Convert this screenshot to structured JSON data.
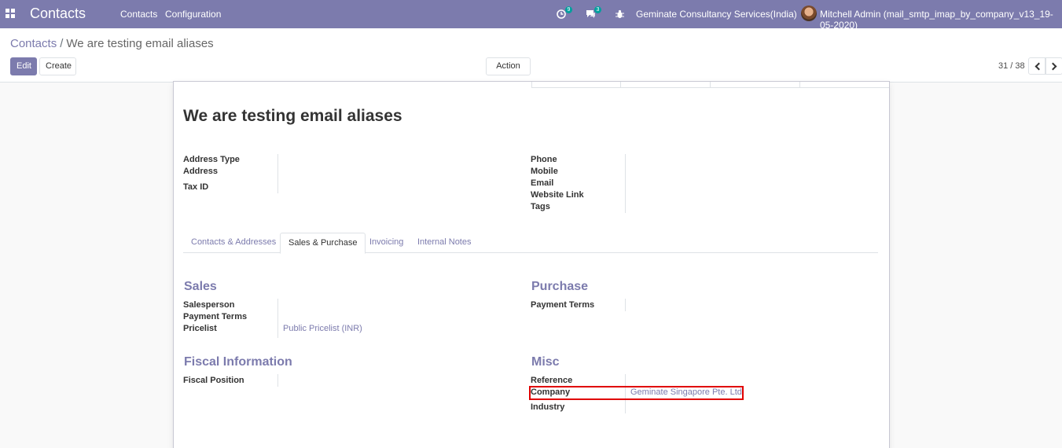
{
  "navbar": {
    "brand": "Contacts",
    "menu": [
      "Contacts",
      "Configuration"
    ],
    "activity_count": "9",
    "messages_count": "3",
    "company": "Geminate Consultancy Services(India)",
    "user": "Mitchell Admin (mail_smtp_imap_by_company_v13_19-05-2020)"
  },
  "breadcrumb": {
    "parent": "Contacts",
    "separator": "/",
    "current": "We are testing email aliases"
  },
  "buttons": {
    "edit": "Edit",
    "create": "Create",
    "action": "Action"
  },
  "pager": {
    "value": "31 / 38"
  },
  "record": {
    "name": "We are testing email aliases",
    "left_fields": [
      "Address Type",
      "Address",
      "Tax ID"
    ],
    "right_fields": [
      "Phone",
      "Mobile",
      "Email",
      "Website Link",
      "Tags"
    ]
  },
  "tabs": [
    "Contacts & Addresses",
    "Sales & Purchase",
    "Invoicing",
    "Internal Notes"
  ],
  "sales": {
    "title": "Sales",
    "salesperson_label": "Salesperson",
    "payment_terms_label": "Payment Terms",
    "pricelist_label": "Pricelist",
    "pricelist_value": "Public Pricelist (INR)"
  },
  "purchase": {
    "title": "Purchase",
    "payment_terms_label": "Payment Terms"
  },
  "fiscal": {
    "title": "Fiscal Information",
    "fiscal_position_label": "Fiscal Position"
  },
  "misc": {
    "title": "Misc",
    "reference_label": "Reference",
    "company_label": "Company",
    "company_value": "Geminate Singapore Pte. Ltd",
    "industry_label": "Industry"
  },
  "colors": {
    "brand": "#7c7bad",
    "highlight": "#e00000"
  }
}
